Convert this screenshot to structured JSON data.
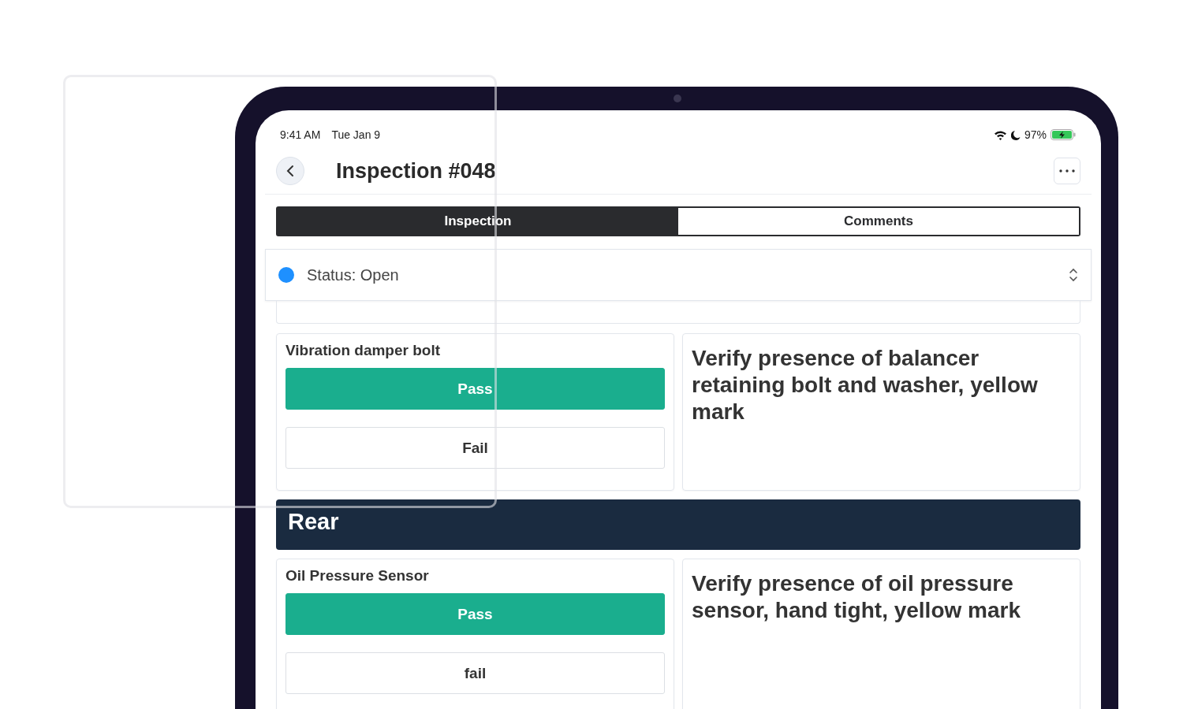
{
  "status_bar": {
    "time": "9:41 AM",
    "date": "Tue Jan 9",
    "battery": "97%"
  },
  "header": {
    "title": "Inspection #048"
  },
  "tabs": [
    {
      "label": "Inspection",
      "selected": true
    },
    {
      "label": "Comments",
      "selected": false
    }
  ],
  "status": {
    "label": "Status: Open",
    "color": "#1e90ff"
  },
  "items": [
    {
      "kind": "check",
      "name": "Vibration damper bolt",
      "options": [
        {
          "label": "Pass",
          "selected": true
        },
        {
          "label": "Fail",
          "selected": false
        }
      ],
      "description": "Verify presence of balancer retaining bolt and washer, yellow mark"
    },
    {
      "kind": "section",
      "title": "Rear"
    },
    {
      "kind": "check",
      "name": "Oil Pressure Sensor",
      "options": [
        {
          "label": "Pass",
          "selected": true
        },
        {
          "label": "fail",
          "selected": false
        }
      ],
      "description": "Verify presence of oil pressure sensor, hand tight, yellow mark"
    }
  ]
}
